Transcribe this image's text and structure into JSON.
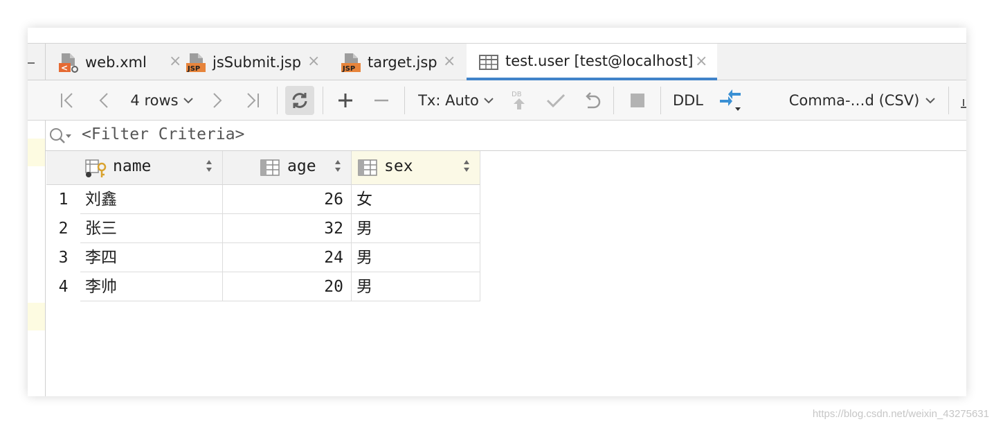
{
  "tabs": [
    {
      "label": "web.xml",
      "icon": "xml-file-icon",
      "active": false
    },
    {
      "label": "jsSubmit.jsp",
      "icon": "jsp-file-icon",
      "active": false
    },
    {
      "label": "target.jsp",
      "icon": "jsp-file-icon",
      "active": false
    },
    {
      "label": "test.user [test@localhost]",
      "icon": "table-icon",
      "active": true
    }
  ],
  "file_icon_badges": {
    "xml": "<",
    "jsp": "JSP"
  },
  "tab_close_glyph": "×",
  "toolbar": {
    "rows_label": "4 rows",
    "tx_label": "Tx: Auto",
    "db_badge": "DB",
    "ddl_label": "DDL",
    "export_format_label": "Comma-…d (CSV)"
  },
  "filter": {
    "placeholder": "<Filter Criteria>"
  },
  "table": {
    "columns": [
      {
        "name": "name",
        "icon": "primary-key-column-icon",
        "sorted": false
      },
      {
        "name": "age",
        "icon": "column-icon",
        "sorted": false
      },
      {
        "name": "sex",
        "icon": "column-icon",
        "sorted": true
      }
    ],
    "rows": [
      {
        "num": "1",
        "name": "刘鑫",
        "age": "26",
        "sex": "女"
      },
      {
        "num": "2",
        "name": "张三",
        "age": "32",
        "sex": "男"
      },
      {
        "num": "3",
        "name": "李四",
        "age": "24",
        "sex": "男"
      },
      {
        "num": "4",
        "name": "李帅",
        "age": "20",
        "sex": "男"
      }
    ]
  },
  "watermark": "https://blog.csdn.net/weixin_43275631",
  "colors": {
    "accent": "#4083c9",
    "jsp_badge": "#e7843b",
    "xml_badge": "#e56a33",
    "key": "#d9a32f",
    "sorted_header": "#fbf9e6"
  }
}
